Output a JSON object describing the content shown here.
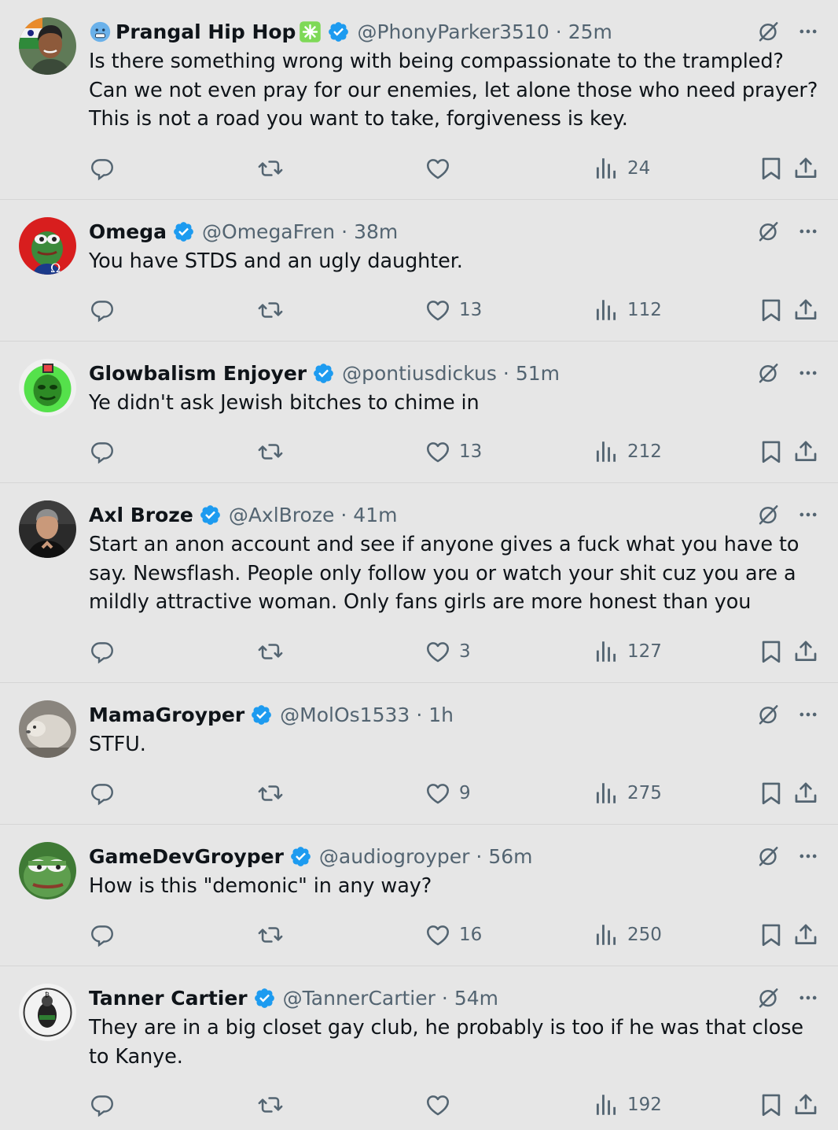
{
  "tweets": [
    {
      "name": "Prangal Hip Hop",
      "handle": "@PhonyParker3510",
      "time": "25m",
      "text": "Is there something wrong with being compassionate to the trampled? Can we not even pray for our enemies, let alone those who need prayer? This is not a road you want to take, forgiveness is key.",
      "likes": "",
      "views": "24"
    },
    {
      "name": "Omega",
      "handle": "@OmegaFren",
      "time": "38m",
      "text": "You have STDS and an ugly daughter.",
      "likes": "13",
      "views": "112"
    },
    {
      "name": "Glowbalism Enjoyer",
      "handle": "@pontiusdickus",
      "time": "51m",
      "text": "Ye didn't ask Jewish bitches to chime in",
      "likes": "13",
      "views": "212"
    },
    {
      "name": "Axl Broze",
      "handle": "@AxlBroze",
      "time": "41m",
      "text": "Start an anon account and see if anyone gives a fuck what you have to say. Newsflash. People only follow you or watch your shit cuz you are a mildly attractive woman. Only fans girls are more honest than you",
      "likes": "3",
      "views": "127"
    },
    {
      "name": "MamaGroyper",
      "handle": "@MolOs1533",
      "time": "1h",
      "text": "STFU.",
      "likes": "9",
      "views": "275"
    },
    {
      "name": "GameDevGroyper",
      "handle": "@audiogroyper",
      "time": "56m",
      "text": "How is this \"demonic\" in any way?",
      "likes": "16",
      "views": "250"
    },
    {
      "name": "Tanner Cartier",
      "handle": "@TannerCartier",
      "time": "54m",
      "text": "They are in a big closet gay club, he probably is too if he was that close to Kanye.",
      "likes": "",
      "views": "192"
    }
  ],
  "dot": "·",
  "colors": {
    "background": "#e6e6e6",
    "verified": "#1d9bf0",
    "muted": "#536471",
    "text": "#0f1419"
  },
  "icons": [
    "reply-icon",
    "retweet-icon",
    "like-icon",
    "views-icon",
    "bookmark-icon",
    "share-icon",
    "grok-icon",
    "more-icon",
    "verified-badge-icon"
  ]
}
